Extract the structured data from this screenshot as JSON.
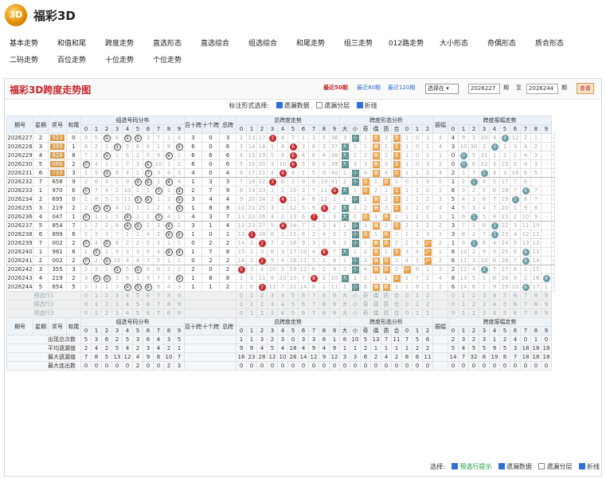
{
  "brand": {
    "logo": "3D",
    "title": "福彩3D"
  },
  "nav": {
    "row1": [
      "基本走势",
      "和值和尾",
      "跨度走势",
      "直选形态",
      "直选综合",
      "组选综合",
      "和尾走势",
      "组三走势",
      "012路走势",
      "大小形态",
      "奇偶形态",
      "质合形态"
    ],
    "row2": [
      "二码走势",
      "百位走势",
      "十位走势",
      "个位走势"
    ]
  },
  "panel": {
    "title": "福彩3D跨度走势图",
    "recent": [
      "最近50期",
      "最近80期",
      "最近120期"
    ],
    "select": "选择在 ▾",
    "from_value": "2026227",
    "from_label": "期",
    "to_label": "至",
    "to_value": "2026244",
    "to_label2": "期",
    "query": "查看"
  },
  "options": {
    "label": "标注形式选择:",
    "items": [
      "遗漏数据",
      "遗漏分层",
      "折线"
    ],
    "checked": [
      true,
      false,
      true
    ]
  },
  "headers": {
    "issue": "期号",
    "week": "星期",
    "prize": "奖号",
    "sum": "和尾",
    "g1": "组选号码分布",
    "bs": "百十跨",
    "sg": "十个跨",
    "zk": "总跨",
    "g2": "总跨度走势",
    "g3": "跨度形态分析",
    "mod": "振幅",
    "g4": "跨度振幅走势",
    "digits": [
      "0",
      "1",
      "2",
      "3",
      "4",
      "5",
      "6",
      "7",
      "8",
      "9"
    ],
    "shape": [
      "大",
      "小",
      "奇",
      "偶",
      "质",
      "合",
      "0",
      "1",
      "2"
    ]
  },
  "rows": [
    {
      "issue": "2026227",
      "week": "2",
      "prize": "523",
      "sum": "0",
      "g1": "9,5,②,6,⑤,⑤,3,7,1,4",
      "bs": "3",
      "sg": "0",
      "zk": "3",
      "kd": "2,13,17,3*,4,7,1,3,5,36",
      "sh": "3,小,1,奇,2,质,1,0,2,4",
      "amp": "4",
      "kz": "9,3,29,4,4*,12,2,1,-,-",
      "g": 1
    },
    {
      "issue": "2026228",
      "week": "3",
      "prize": "399",
      "sum": "1",
      "g1": "6,2,1,③,5,6,6,1,8,⑨",
      "bs": "6",
      "sg": "0",
      "zk": "6",
      "kd": "3,14,18,1,8,6*,3,6,3,37",
      "sh": "大,1,1,偶,1,合,1,0,1,4",
      "amp": "3",
      "kz": "10,30,3,3*,1,3,4,2,-,-",
      "g": 1
    },
    {
      "issue": "2026229",
      "week": "4",
      "prize": "828",
      "sum": "8",
      "g1": "7,3,②,1,6,2,5,9,⑧,1",
      "bs": "6",
      "sg": "6",
      "zk": "6",
      "kd": "4,15,19,5,8,6*,4,6,4,38",
      "sh": "大,2,2,偶,2,合,1,0,2,1",
      "amp": "0",
      "kz": "0*,5,31,1,2,1,4,3,-,-",
      "g": 1
    },
    {
      "issue": "2026230",
      "week": "5",
      "prize": "066",
      "sum": "2",
      "g1": "⓪,4,1,2,7,3,⑥,10,1,2",
      "bs": "6",
      "sg": "0",
      "zk": "6",
      "kd": "5,16,20,3,10,6*,5,8,5,39",
      "sh": "大,3,3,偶,3,合,1,0,3,2",
      "amp": "0",
      "kz": "0*,6,32,3,15,5,4,3,-,-",
      "g": 1
    },
    {
      "issue": "2026231",
      "week": "6",
      "prize": "733",
      "sum": "3",
      "g1": "1,5,③,8,4,1,⑦,3,4,3",
      "bs": "4",
      "sg": "0",
      "zk": "4",
      "kd": "6,17,21,4,4*,8,1,5,9,40",
      "sh": "1,小,4,偶,4,合,1,1,2,4",
      "amp": "2",
      "kz": "1,7,2*,4,3,16,6,5,-,-",
      "g": 1,
      "sep": 1
    },
    {
      "issue": "2026232",
      "week": "7",
      "prize": "658",
      "sum": "9",
      "g1": "2,6,3,1,9,⑤,⑥,1,⑧,4",
      "bs": "1",
      "sg": "3",
      "zk": "3",
      "kd": "7,18,22,3*,6,2,9,6,10,41",
      "sh": "2,小,奇,1,质,1,0,1,9,5",
      "amp": "1",
      "kz": "2,1*,4,5,17,7,6,-,-,-",
      "g": 0
    },
    {
      "issue": "2026233",
      "week": "1",
      "prize": "970",
      "sum": "6",
      "g1": "⓪,7,4,2,10,1,1,⑦,1,⑨",
      "bs": "2",
      "sg": "7",
      "zk": "9",
      "kd": "8,19,23,1,2,10,3,7,11,9*",
      "sh": "大,1,奇,2,1,合,1,1,0,2",
      "amp": "6",
      "kz": "3,2,5,6,18,7,6*,7,-,-",
      "g": 0
    },
    {
      "issue": "2026234",
      "week": "2",
      "prize": "695",
      "sum": "0",
      "g1": "1,8,5,3,11,⑤,⑥,1,2,⑨",
      "bs": "3",
      "sg": "4",
      "zk": "4",
      "kd": "9,20,24,2,4*,11,4,8,12,1",
      "sh": "1,小,1,偶,2,合,1,1,2,3",
      "amp": "5",
      "kz": "4,3,6,7,19,5*,8,7,-,-",
      "g": 0
    },
    {
      "issue": "2026235",
      "week": "3",
      "prize": "219",
      "sum": "2",
      "g1": "2,①,②,4,12,1,1,2,3,⑨",
      "bs": "1",
      "sg": "8",
      "zk": "8",
      "kd": "10,21,25,3,1,12,5,9,8*,2",
      "sh": "大,1,2,偶,3,合,1,2,0,4",
      "amp": "4",
      "kz": "5,3,4,7,20,1,9,8,-,-",
      "g": 0
    },
    {
      "issue": "2026236",
      "week": "4",
      "prize": "047",
      "sum": "1",
      "g1": "⓪,1,1,5,④,2,2,⑦,4,1",
      "bs": "4",
      "sg": "3",
      "zk": "7",
      "kd": "11,22,26,4,2,13,6,7*,1,3",
      "sh": "大,2,奇,1,质,1,1,2,1,1",
      "amp": "1",
      "kz": "6,1*,5,8,21,2,10,9,-,-",
      "g": 0,
      "sep": 1
    },
    {
      "issue": "2026237",
      "week": "5",
      "prize": "854",
      "kind": "",
      "sum": "7",
      "g1": "1,2,2,6,④,⑤,1,3,⑧,2",
      "bs": "3",
      "sg": "1",
      "zk": "4",
      "kd": "12,23,27,5,4*,14,7,1,3,4",
      "sh": "1,小,1,偶,2,合,2,1,2,2",
      "amp": "3",
      "kz": "7,1,6,3*,22,3,11,10,-,-",
      "g": 0
    },
    {
      "issue": "2026238",
      "week": "6",
      "prize": "899",
      "sum": "6",
      "g1": "2,3,3,7,1,1,4,2,⑧,⑨",
      "bs": "1",
      "sg": "0",
      "zk": "1",
      "kd": "13,1*,28,6,1,15,8,2,4,5",
      "sh": "2,小,奇,1,质,1,1,2,3,1",
      "amp": "3",
      "kz": "8,2,7,3*,23,4,12,11,-,-",
      "g": 0
    },
    {
      "issue": "2026239",
      "week": "7",
      "prize": "002",
      "sum": "2",
      "g1": "⓪,4,②,8,2,2,5,3,1,1",
      "bs": "0",
      "sg": "2",
      "zk": "2",
      "kd": "14,2,2*,7,2,16,9,3,5,6",
      "sh": "3,小,1,偶,质,2,2,3,2*,2",
      "amp": "1",
      "kz": "9,1*,8,4,24,5,13,12,-,-",
      "g": 0
    },
    {
      "issue": "2026240",
      "week": "1",
      "prize": "981",
      "sum": "8",
      "g1": "1,①,1,9,3,3,6,4,⑧,⑨",
      "bs": "1",
      "sg": "7",
      "zk": "8",
      "kd": "15,1,3,8,3,17,10,4,8*,7",
      "sh": "大,1,2,偶,1,合,3,4,2*,1",
      "amp": "6",
      "kz": "10,2,9,5,25,6,6*,13,-,-",
      "g": 0
    },
    {
      "issue": "2026241",
      "week": "2",
      "prize": "002",
      "sum": "2",
      "g1": "⓪,2,②,10,4,4,7,5,1,1",
      "bs": "0",
      "sg": "2",
      "zk": "2",
      "kd": "16,2,2*,9,4,18,11,5,1,8",
      "sh": "1,小,3,偶,质,1,4,5,2*,2",
      "amp": "6",
      "kz": "11,3,10,6,26,7,6*,14,-,-",
      "g": 0,
      "sep": 1
    },
    {
      "issue": "2026242",
      "week": "3",
      "prize": "355",
      "sum": "3",
      "g1": "2,3,1,③,5,⑤,8,6,2,2",
      "bs": "2",
      "sg": "0",
      "zk": "2",
      "kd": "0*,3,4,10,5,19,12,6,2,9",
      "sh": "2,小,4,偶,质,2,0*,6,1,3",
      "amp": "2",
      "kz": "12,4,2*,7,27,8,1,15,-,-",
      "g": 0
    },
    {
      "issue": "2026243",
      "week": "4",
      "prize": "219",
      "sum": "2",
      "g1": "3,①,②,1,6,1,9,7,3,⑨",
      "bs": "1",
      "sg": "8",
      "zk": "8",
      "kd": "1,5,11,6,20,13,7,8*,2,10",
      "sh": "大,1,5,1,1,合,1,7,2,4",
      "amp": "8",
      "kz": "13,5,1,8,28,9,2,16,8*,-",
      "g": 0
    },
    {
      "issue": "2026244",
      "week": "5",
      "prize": "654",
      "sum": "5",
      "g1": "3,1,1,3,④,⑤,⑥,8,4,3",
      "bs": "1",
      "sg": "1",
      "zk": "2",
      "kd": "2,6,2*,12,7,21,14,8,1,11",
      "sh": "1,小,6,偶,质,1,1,8,2,2",
      "amp": "6",
      "kz": "14,6,2,9,29,10,6*,17,1,-",
      "g": 0
    }
  ],
  "predict": [
    "预选行1",
    "预选行2",
    "预选行3"
  ],
  "stats": {
    "labels": [
      "出现总次数",
      "平均遗漏值",
      "最大遗漏值",
      "最大连出数"
    ],
    "g1": [
      [
        "5",
        "3",
        "6",
        "2",
        "5",
        "3",
        "6",
        "4",
        "3",
        "5",
        "7"
      ],
      [
        "2",
        "4",
        "2",
        "5",
        "4",
        "2",
        "3",
        "4",
        "2",
        "1"
      ],
      [
        "7",
        "8",
        "5",
        "13",
        "12",
        "4",
        "9",
        "8",
        "10",
        "7"
      ],
      [
        "0",
        "0",
        "0",
        "0",
        "0",
        "2",
        "0",
        "0",
        "2",
        "3"
      ]
    ],
    "kd": [
      [
        "1",
        "1",
        "3",
        "2",
        "3",
        "0",
        "3",
        "3",
        "8",
        "1"
      ],
      [
        "9",
        "9",
        "4",
        "5",
        "4",
        "18",
        "4",
        "9",
        "4",
        "9"
      ],
      [
        "16",
        "23",
        "28",
        "12",
        "10",
        "28",
        "14",
        "12",
        "9",
        "12",
        "41"
      ],
      [
        "0",
        "0",
        "0",
        "0",
        "0",
        "0",
        "0",
        "0",
        "0",
        "0"
      ]
    ],
    "sh": [
      [
        "8",
        "10",
        "5",
        "13",
        "7",
        "11",
        "7",
        "5",
        "6"
      ],
      [
        "1",
        "1",
        "2",
        "1",
        "1",
        "1",
        "1",
        "2",
        "2"
      ],
      [
        "3",
        "3",
        "6",
        "2",
        "4",
        "2",
        "8",
        "6",
        "11"
      ],
      [
        "0",
        "0",
        "0",
        "0",
        "0",
        "0",
        "0",
        "0",
        "0"
      ]
    ],
    "kz": [
      [
        "2",
        "3",
        "2",
        "3",
        "1",
        "2",
        "4",
        "0",
        "1",
        "0"
      ],
      [
        "5",
        "4",
        "5",
        "5",
        "9",
        "5",
        "3",
        "18",
        "18",
        "18"
      ],
      [
        "14",
        "7",
        "32",
        "8",
        "19",
        "8",
        "7",
        "18",
        "18",
        "18"
      ],
      [
        "0",
        "0",
        "0",
        "0",
        "0",
        "0",
        "0",
        "0",
        "0",
        "0"
      ]
    ]
  },
  "footer": {
    "label": "选择:",
    "items": [
      "预选行提示",
      "遗漏数据",
      "遗漏分层",
      "折线"
    ]
  }
}
